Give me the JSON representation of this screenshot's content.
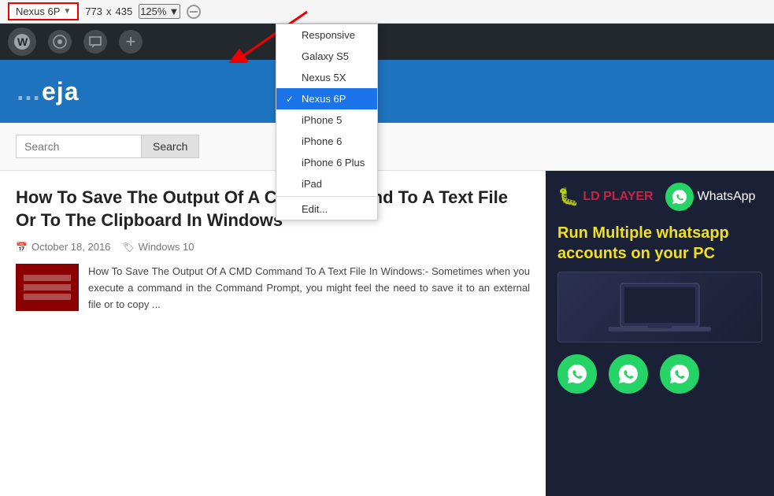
{
  "toolbar": {
    "device_selector_label": "Nexus 6P",
    "dropdown_arrow": "▼",
    "width": "773",
    "x_separator": "x",
    "height": "435",
    "zoom": "125%",
    "zoom_arrow": "▼"
  },
  "dropdown": {
    "items": [
      {
        "id": "responsive",
        "label": "Responsive",
        "selected": false
      },
      {
        "id": "galaxy-s5",
        "label": "Galaxy S5",
        "selected": false
      },
      {
        "id": "nexus-5x",
        "label": "Nexus 5X",
        "selected": false
      },
      {
        "id": "nexus-6p",
        "label": "Nexus 6P",
        "selected": true
      },
      {
        "id": "iphone-5",
        "label": "iPhone 5",
        "selected": false
      },
      {
        "id": "iphone-6",
        "label": "iPhone 6",
        "selected": false
      },
      {
        "id": "iphone-6-plus",
        "label": "iPhone 6 Plus",
        "selected": false
      },
      {
        "id": "ipad",
        "label": "iPad",
        "selected": false
      },
      {
        "id": "edit",
        "label": "Edit...",
        "selected": false
      }
    ]
  },
  "wp_admin": {
    "wordpress_icon": "W",
    "customize_icon": "🎨",
    "feedback_icon": "💬",
    "add_icon": "+"
  },
  "site_header": {
    "title": "eja"
  },
  "search": {
    "placeholder": "Search",
    "button_label": "Search"
  },
  "article": {
    "title": "How To Save The Output Of A CMD Command To A Text File Or To The Clipboard In Windows",
    "date": "October 18, 2016",
    "category": "Windows 10",
    "excerpt": "How To Save The Output Of A CMD Command To A Text File In Windows:- Sometimes when you execute a command in the Command Prompt, you might feel the need to save it to an external file or to copy ..."
  },
  "ad": {
    "ldplayer_name": "LD PLAYER",
    "whatsapp_label": "WhatsApp",
    "tagline": "Run Multiple whatsapp accounts on your PC"
  },
  "colors": {
    "site_header_bg": "#1e73be",
    "wp_admin_bg": "#23282d",
    "ad_bg": "#1a2035",
    "ad_tagline": "#f0e020",
    "selected_item_bg": "#1a73e8"
  }
}
